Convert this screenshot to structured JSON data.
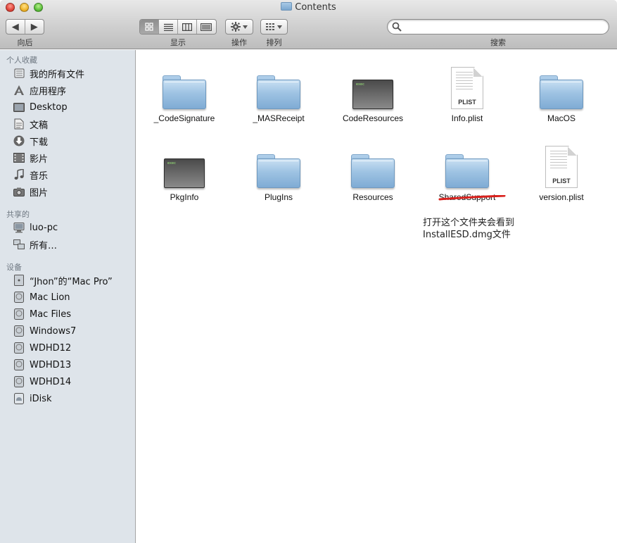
{
  "window": {
    "title": "Contents"
  },
  "toolbar": {
    "back_label": "向后",
    "view_label": "显示",
    "action_label": "操作",
    "arrange_label": "排列",
    "search_label": "搜索",
    "search_value": "",
    "back_glyph": "◀",
    "forward_glyph": "▶",
    "view_icons": [
      "icon-view-icon",
      "list-view-icon",
      "column-view-icon",
      "coverflow-view-icon"
    ],
    "active_view": 0
  },
  "sidebar": {
    "favorites_header": "个人收藏",
    "favorites": [
      {
        "label": "我的所有文件",
        "icon": "all-files-icon"
      },
      {
        "label": "应用程序",
        "icon": "applications-icon"
      },
      {
        "label": "Desktop",
        "icon": "desktop-icon"
      },
      {
        "label": "文稿",
        "icon": "documents-icon"
      },
      {
        "label": "下载",
        "icon": "downloads-icon"
      },
      {
        "label": "影片",
        "icon": "movies-icon"
      },
      {
        "label": "音乐",
        "icon": "music-icon"
      },
      {
        "label": "图片",
        "icon": "pictures-icon"
      }
    ],
    "shared_header": "共享的",
    "shared": [
      {
        "label": "luo-pc",
        "icon": "computer-icon"
      },
      {
        "label": "所有…",
        "icon": "network-icon"
      }
    ],
    "devices_header": "设备",
    "devices": [
      {
        "label": "“Jhon”的“Mac Pro”",
        "icon": "mac-pro-icon"
      },
      {
        "label": "Mac Lion",
        "icon": "hard-drive-icon"
      },
      {
        "label": "Mac Files",
        "icon": "hard-drive-icon"
      },
      {
        "label": "Windows7",
        "icon": "hard-drive-icon"
      },
      {
        "label": "WDHD12",
        "icon": "hard-drive-icon"
      },
      {
        "label": "WDHD13",
        "icon": "hard-drive-icon"
      },
      {
        "label": "WDHD14",
        "icon": "hard-drive-icon"
      },
      {
        "label": "iDisk",
        "icon": "idisk-icon"
      }
    ]
  },
  "files": [
    {
      "name": "_CodeSignature",
      "kind": "folder"
    },
    {
      "name": "_MASReceipt",
      "kind": "folder"
    },
    {
      "name": "CodeResources",
      "kind": "exec"
    },
    {
      "name": "Info.plist",
      "kind": "plist"
    },
    {
      "name": "MacOS",
      "kind": "folder"
    },
    {
      "name": "PkgInfo",
      "kind": "exec"
    },
    {
      "name": "PlugIns",
      "kind": "folder"
    },
    {
      "name": "Resources",
      "kind": "folder"
    },
    {
      "name": "SharedSupport",
      "kind": "folder"
    },
    {
      "name": "version.plist",
      "kind": "plist"
    }
  ],
  "icon_text": {
    "exec": "exec",
    "plist": "PLIST"
  },
  "annotation": {
    "line1": "打开这个文件夹会看到",
    "line2": "InstallESD.dmg文件",
    "underline_color": "#d9201c"
  }
}
